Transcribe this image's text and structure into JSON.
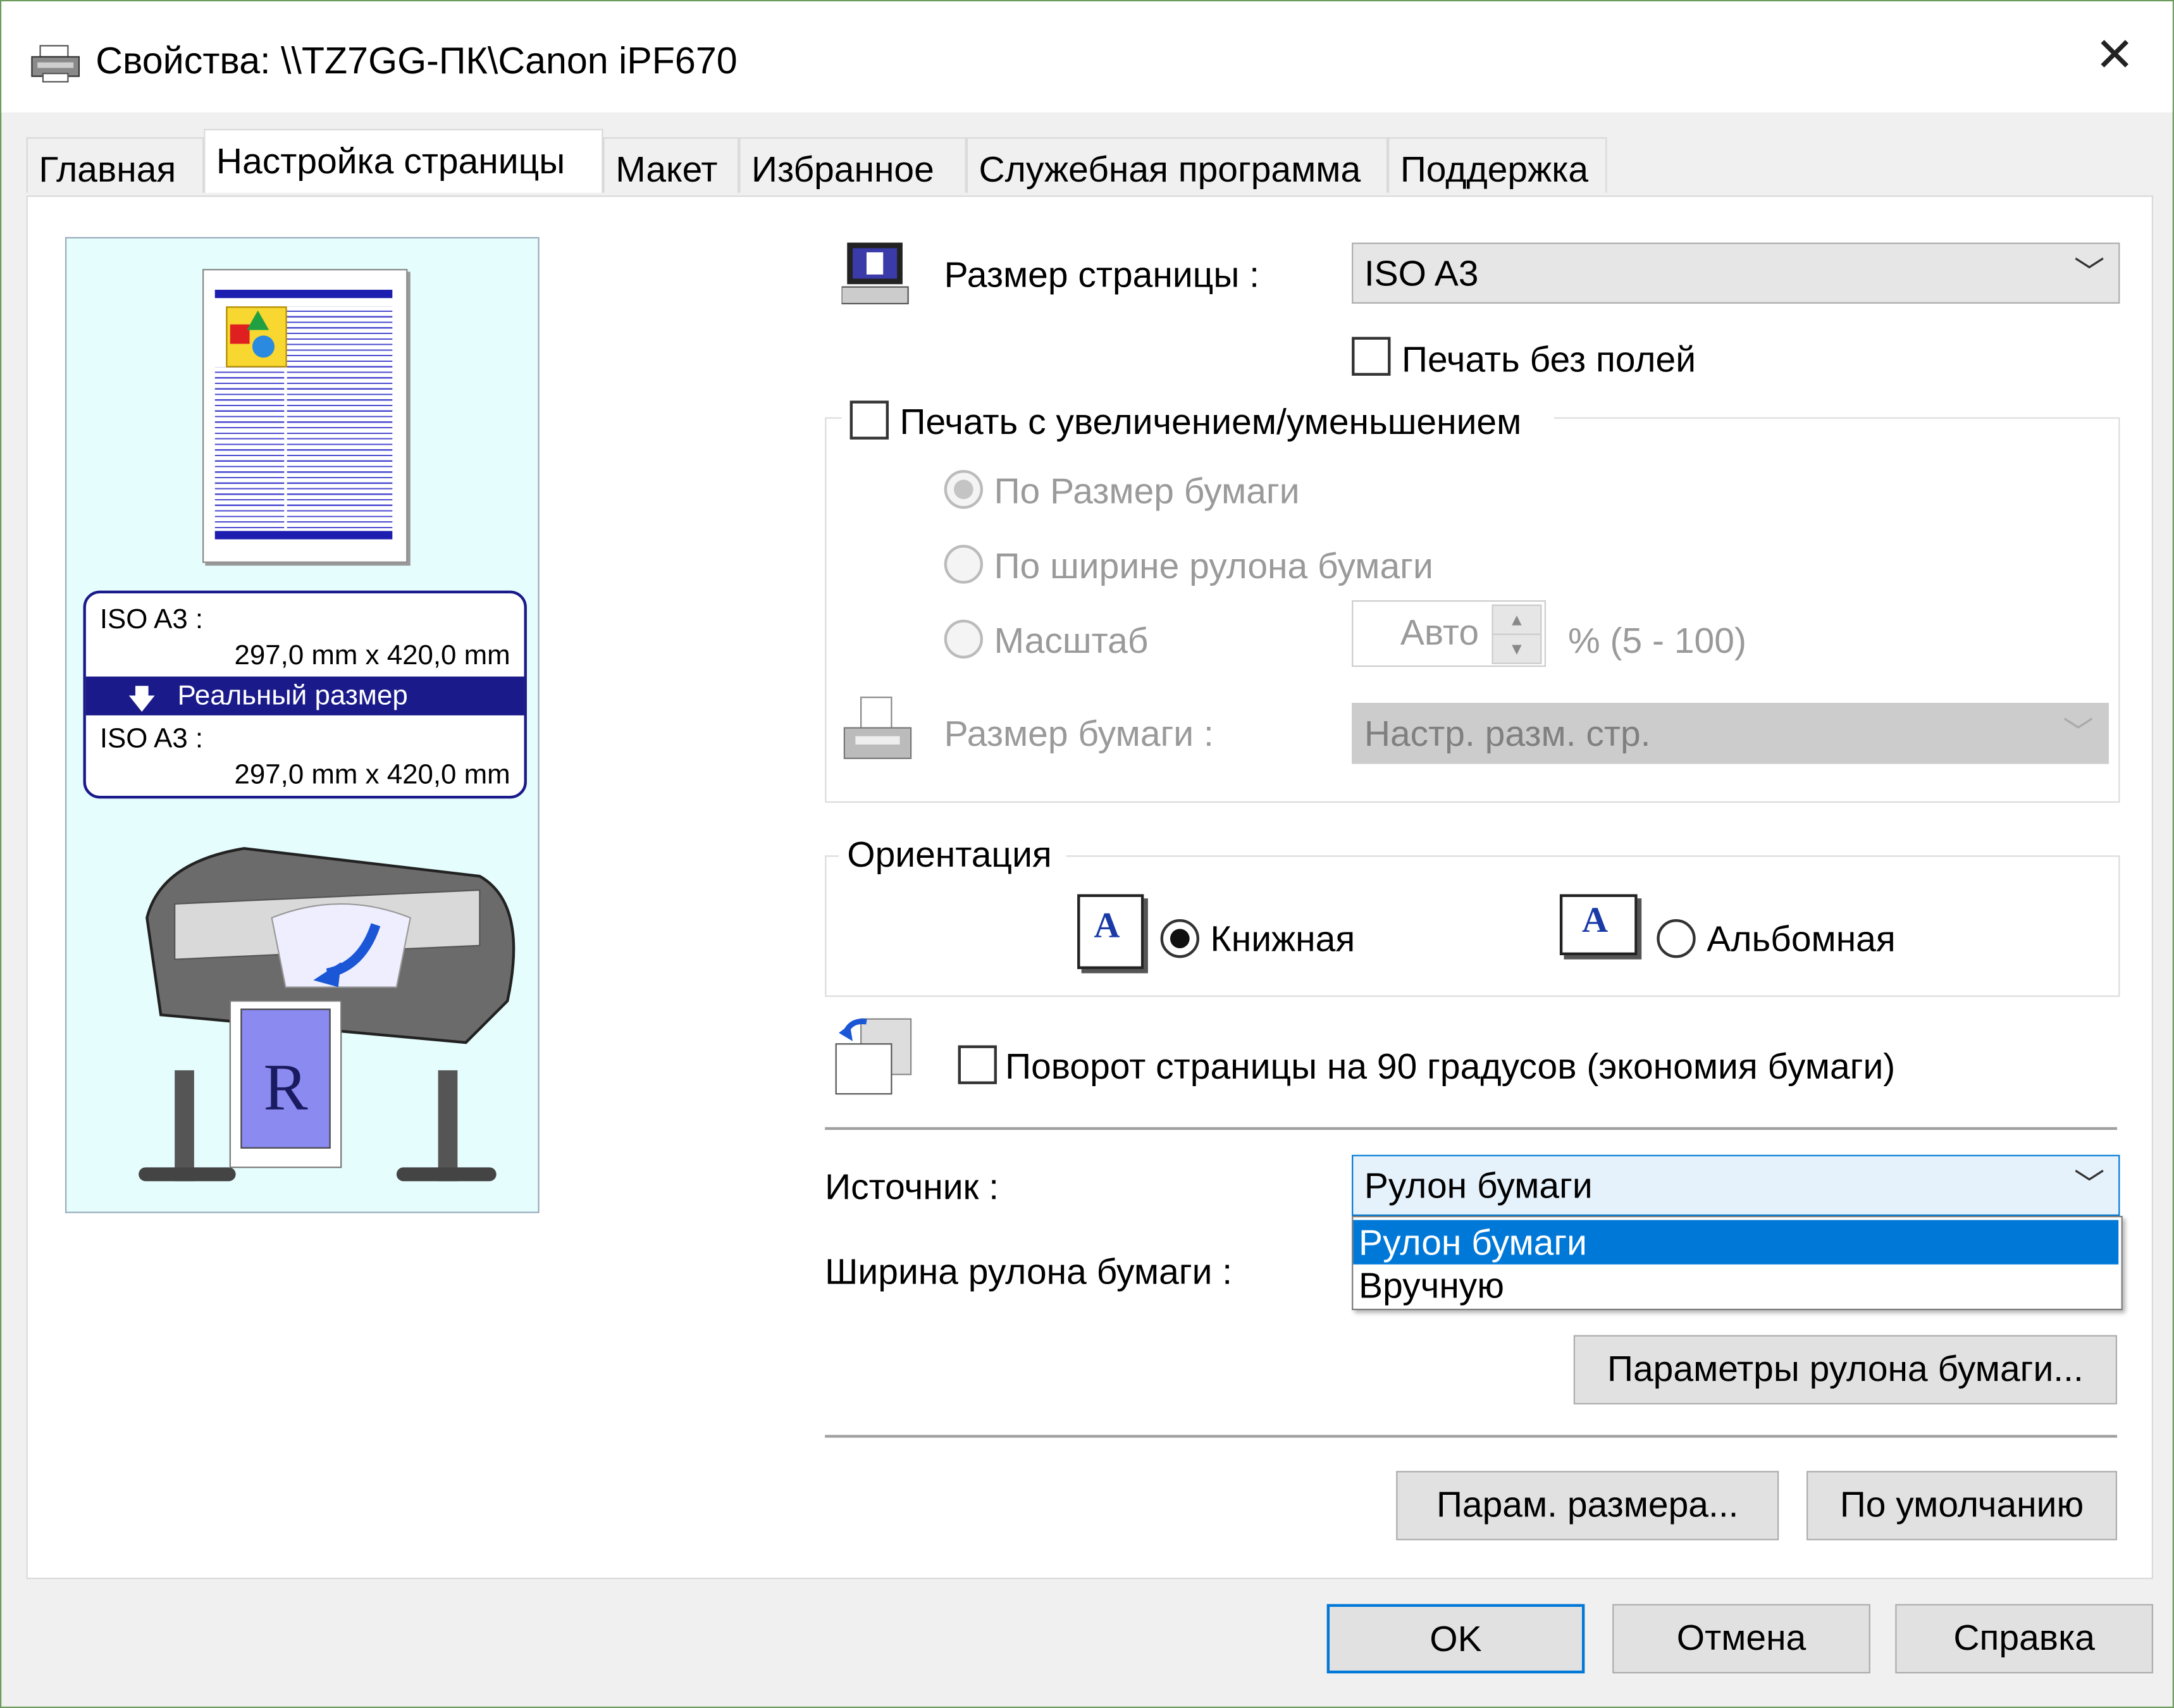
{
  "window": {
    "title": "Свойства: \\\\TZ7GG-ПК\\Canon iPF670"
  },
  "tabs": [
    {
      "label": "Главная"
    },
    {
      "label": "Настройка страницы"
    },
    {
      "label": "Макет"
    },
    {
      "label": "Избранное"
    },
    {
      "label": "Служебная программа"
    },
    {
      "label": "Поддержка"
    }
  ],
  "active_tab": "Настройка страницы",
  "preview": {
    "src_size_name": "ISO A3 :",
    "src_size_dims": "297,0 mm x 420,0 mm",
    "mode_label": "Реальный размер",
    "dst_size_name": "ISO A3 :",
    "dst_size_dims": "297,0 mm x 420,0 mm",
    "printer_letter": "R"
  },
  "page_size": {
    "label": "Размер страницы :",
    "value": "ISO A3"
  },
  "borderless": {
    "label": "Печать без полей",
    "checked": false
  },
  "scaling": {
    "label": "Печать с увеличением/уменьшением",
    "checked": false,
    "options": [
      "По Размер бумаги",
      "По ширине рулона бумаги",
      "Масштаб"
    ],
    "selected_option": "По Размер бумаги",
    "scale_value": "Авто",
    "scale_range": "% (5 - 100)",
    "paper_size_label": "Размер бумаги :",
    "paper_size_value": "Настр. разм. стр."
  },
  "orientation": {
    "label": "Ориентация",
    "portrait": "Книжная",
    "landscape": "Альбомная",
    "selected": "Книжная",
    "icon_letter": "A"
  },
  "rotate": {
    "label": "Поворот страницы на 90 градусов (экономия бумаги)",
    "checked": false
  },
  "source": {
    "label": "Источник :",
    "value": "Рулон бумаги",
    "options": [
      "Рулон бумаги",
      "Вручную"
    ],
    "highlighted": "Рулон бумаги"
  },
  "roll_width": {
    "label": "Ширина рулона бумаги :"
  },
  "buttons": {
    "roll_params": "Параметры рулона бумаги...",
    "size_params": "Парам. размера...",
    "defaults": "По умолчанию",
    "ok": "OK",
    "cancel": "Отмена",
    "help": "Справка"
  },
  "colors": {
    "accent": "#0078d7",
    "preview_bg": "#e6fdfd",
    "info_bar": "#1a1a8a"
  }
}
